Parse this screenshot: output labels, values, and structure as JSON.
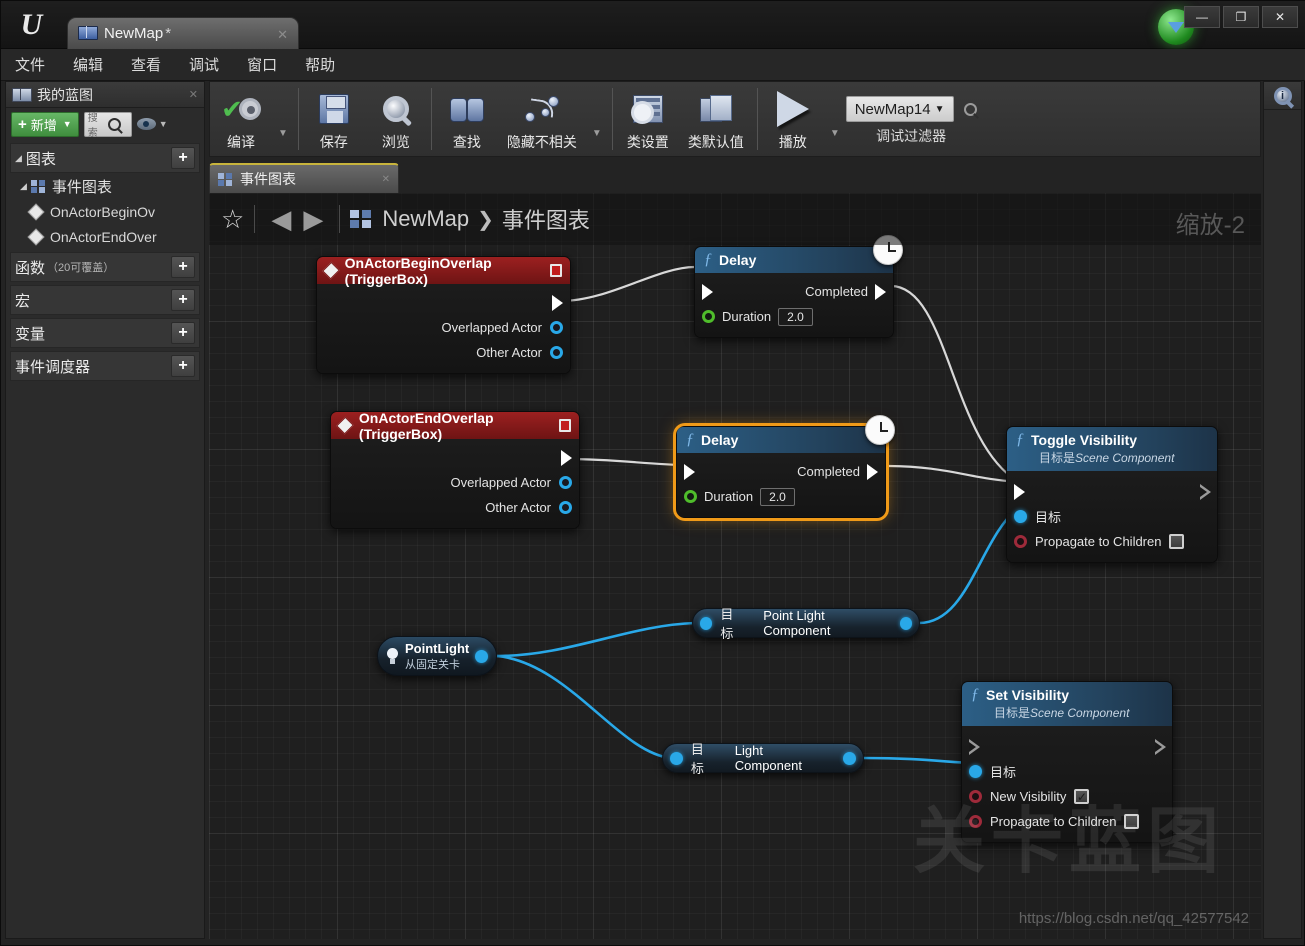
{
  "window": {
    "tab_title": "NewMap",
    "tab_modified": "*",
    "tab_close": "✕",
    "minimize": "—",
    "maximize": "❐",
    "close": "✕"
  },
  "menubar": {
    "items": [
      "文件",
      "编辑",
      "查看",
      "调试",
      "窗口",
      "帮助"
    ]
  },
  "sidebar": {
    "title": "我的蓝图",
    "close": "✕",
    "add_button": "新增",
    "add_plus": "+",
    "caret": "▼",
    "search_placeholder": "搜索",
    "sections": [
      {
        "label": "图表",
        "sub": "",
        "arrow": "◢",
        "plus": "+"
      },
      {
        "label": "函数",
        "sub": "（20可覆盖）",
        "arrow": "",
        "plus": "+"
      },
      {
        "label": "宏",
        "sub": "",
        "arrow": "",
        "plus": "+"
      },
      {
        "label": "变量",
        "sub": "",
        "arrow": "",
        "plus": "+"
      },
      {
        "label": "事件调度器",
        "sub": "",
        "arrow": "",
        "plus": "+"
      }
    ],
    "event_graph_label": "事件图表",
    "events": [
      "OnActorBeginOv",
      "OnActorEndOver"
    ]
  },
  "toolbar": {
    "compile": "编译",
    "save": "保存",
    "browse": "浏览",
    "find": "查找",
    "hide_unrelated": "隐藏不相关",
    "class_settings": "类设置",
    "class_defaults": "类默认值",
    "play": "播放",
    "debug_filter_value": "NewMap14",
    "debug_filter_label": "调试过滤器",
    "caret": "▼"
  },
  "graph_tab": {
    "label": "事件图表",
    "close": "✕"
  },
  "breadcrumb": {
    "star": "☆",
    "back": "◀",
    "forward": "▶",
    "root": "NewMap",
    "chevron": "❯",
    "current": "事件图表",
    "zoom": "缩放-2"
  },
  "watermark": {
    "text": "关卡蓝图",
    "url": "https://blog.csdn.net/qq_42577542"
  },
  "nodes": {
    "begin_overlap": {
      "title": "OnActorBeginOverlap (TriggerBox)",
      "pins": [
        "Overlapped Actor",
        "Other Actor"
      ]
    },
    "end_overlap": {
      "title": "OnActorEndOverlap (TriggerBox)",
      "pins": [
        "Overlapped Actor",
        "Other Actor"
      ]
    },
    "delay1": {
      "title": "Delay",
      "completed": "Completed",
      "duration_label": "Duration",
      "duration_value": "2.0"
    },
    "delay2": {
      "title": "Delay",
      "completed": "Completed",
      "duration_label": "Duration",
      "duration_value": "2.0",
      "selected": true
    },
    "toggle_visibility": {
      "title": "Toggle Visibility",
      "subtitle_prefix": "目标是",
      "subtitle_type": "Scene Component",
      "target": "目标",
      "propagate": "Propagate to Children",
      "propagate_checked": false
    },
    "set_visibility": {
      "title": "Set Visibility",
      "subtitle_prefix": "目标是",
      "subtitle_type": "Scene Component",
      "target": "目标",
      "new_visibility": "New Visibility",
      "new_visibility_checked": true,
      "checkmark": "✓",
      "propagate": "Propagate to Children",
      "propagate_checked": false
    },
    "point_light": {
      "title": "PointLight",
      "subtitle": "从固定关卡"
    },
    "point_light_component": {
      "target": "目标",
      "name": "Point Light Component"
    },
    "light_component": {
      "target": "目标",
      "name": "Light Component"
    }
  },
  "colors": {
    "event_node_header": "#9c2020",
    "function_node_header": "#2c5f86",
    "selection": "#f09a18",
    "exec_wire": "#d8d8d8",
    "object_wire": "#29a8e8",
    "add_button": "#3f8d3e"
  }
}
